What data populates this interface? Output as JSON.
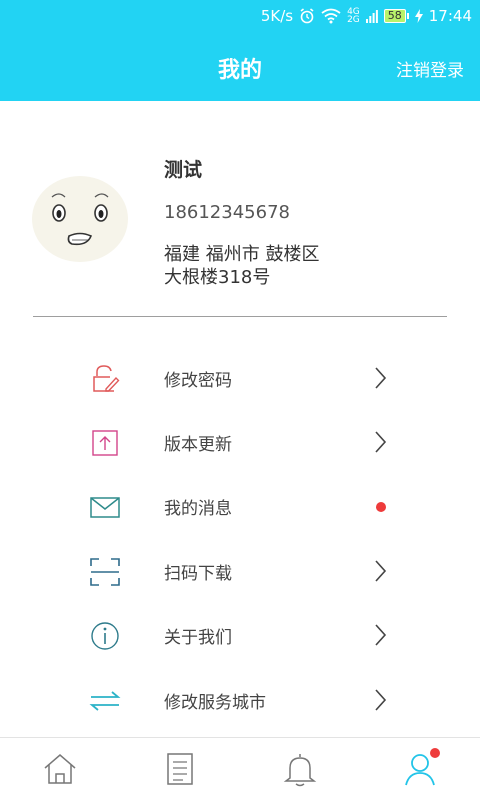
{
  "status": {
    "speed": "5K/s",
    "net_top": "4G",
    "net_bottom": "2G",
    "battery": "58",
    "time": "17:44"
  },
  "header": {
    "title": "我的",
    "logout_label": "注销登录"
  },
  "profile": {
    "name": "测试",
    "phone": "18612345678",
    "address_line1": "福建  福州市  鼓楼区",
    "address_line2": "大根楼318号"
  },
  "menu": [
    {
      "label": "修改密码",
      "icon": "lock-edit-icon",
      "color": "#e05a5a"
    },
    {
      "label": "版本更新",
      "icon": "upload-icon",
      "color": "#d2458a"
    },
    {
      "label": "我的消息",
      "icon": "mail-icon",
      "color": "#2e8b8b",
      "badge": "unread-dot"
    },
    {
      "label": "扫码下载",
      "icon": "scan-icon",
      "color": "#2e6b8b"
    },
    {
      "label": "关于我们",
      "icon": "info-icon",
      "color": "#2e7b8b"
    },
    {
      "label": "修改服务城市",
      "icon": "swap-arrows-icon",
      "color": "#2bb3c8"
    }
  ],
  "bottom_nav": [
    {
      "name": "home",
      "icon": "home-icon"
    },
    {
      "name": "list",
      "icon": "list-icon"
    },
    {
      "name": "notifications",
      "icon": "bell-icon"
    },
    {
      "name": "profile",
      "icon": "user-icon",
      "active": true,
      "badge": "unread-dot"
    }
  ],
  "colors": {
    "header_bg": "#22d3f3",
    "accent": "#22c4e8",
    "badge": "#ee3b3b"
  }
}
